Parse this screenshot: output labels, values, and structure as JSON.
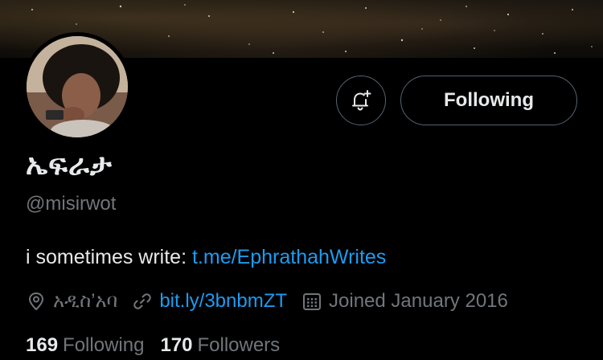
{
  "profile": {
    "display_name": "ኤፍራታ",
    "handle": "@misirwot",
    "bio_text": "i sometimes write: ",
    "bio_link": "t.me/EphrathahWrites",
    "location": "አዲስ’አባ",
    "website": "bit.ly/3bnbmZT",
    "joined": "Joined January 2016",
    "following_count": "169",
    "following_label": "Following",
    "followers_count": "170",
    "followers_label": "Followers"
  },
  "actions": {
    "notify_icon": "bell-plus-icon",
    "follow_label": "Following"
  },
  "colors": {
    "background": "#000000",
    "text_primary": "#e7e9ea",
    "text_secondary": "#71767b",
    "link": "#1d9bf0",
    "button_border": "#536471"
  }
}
